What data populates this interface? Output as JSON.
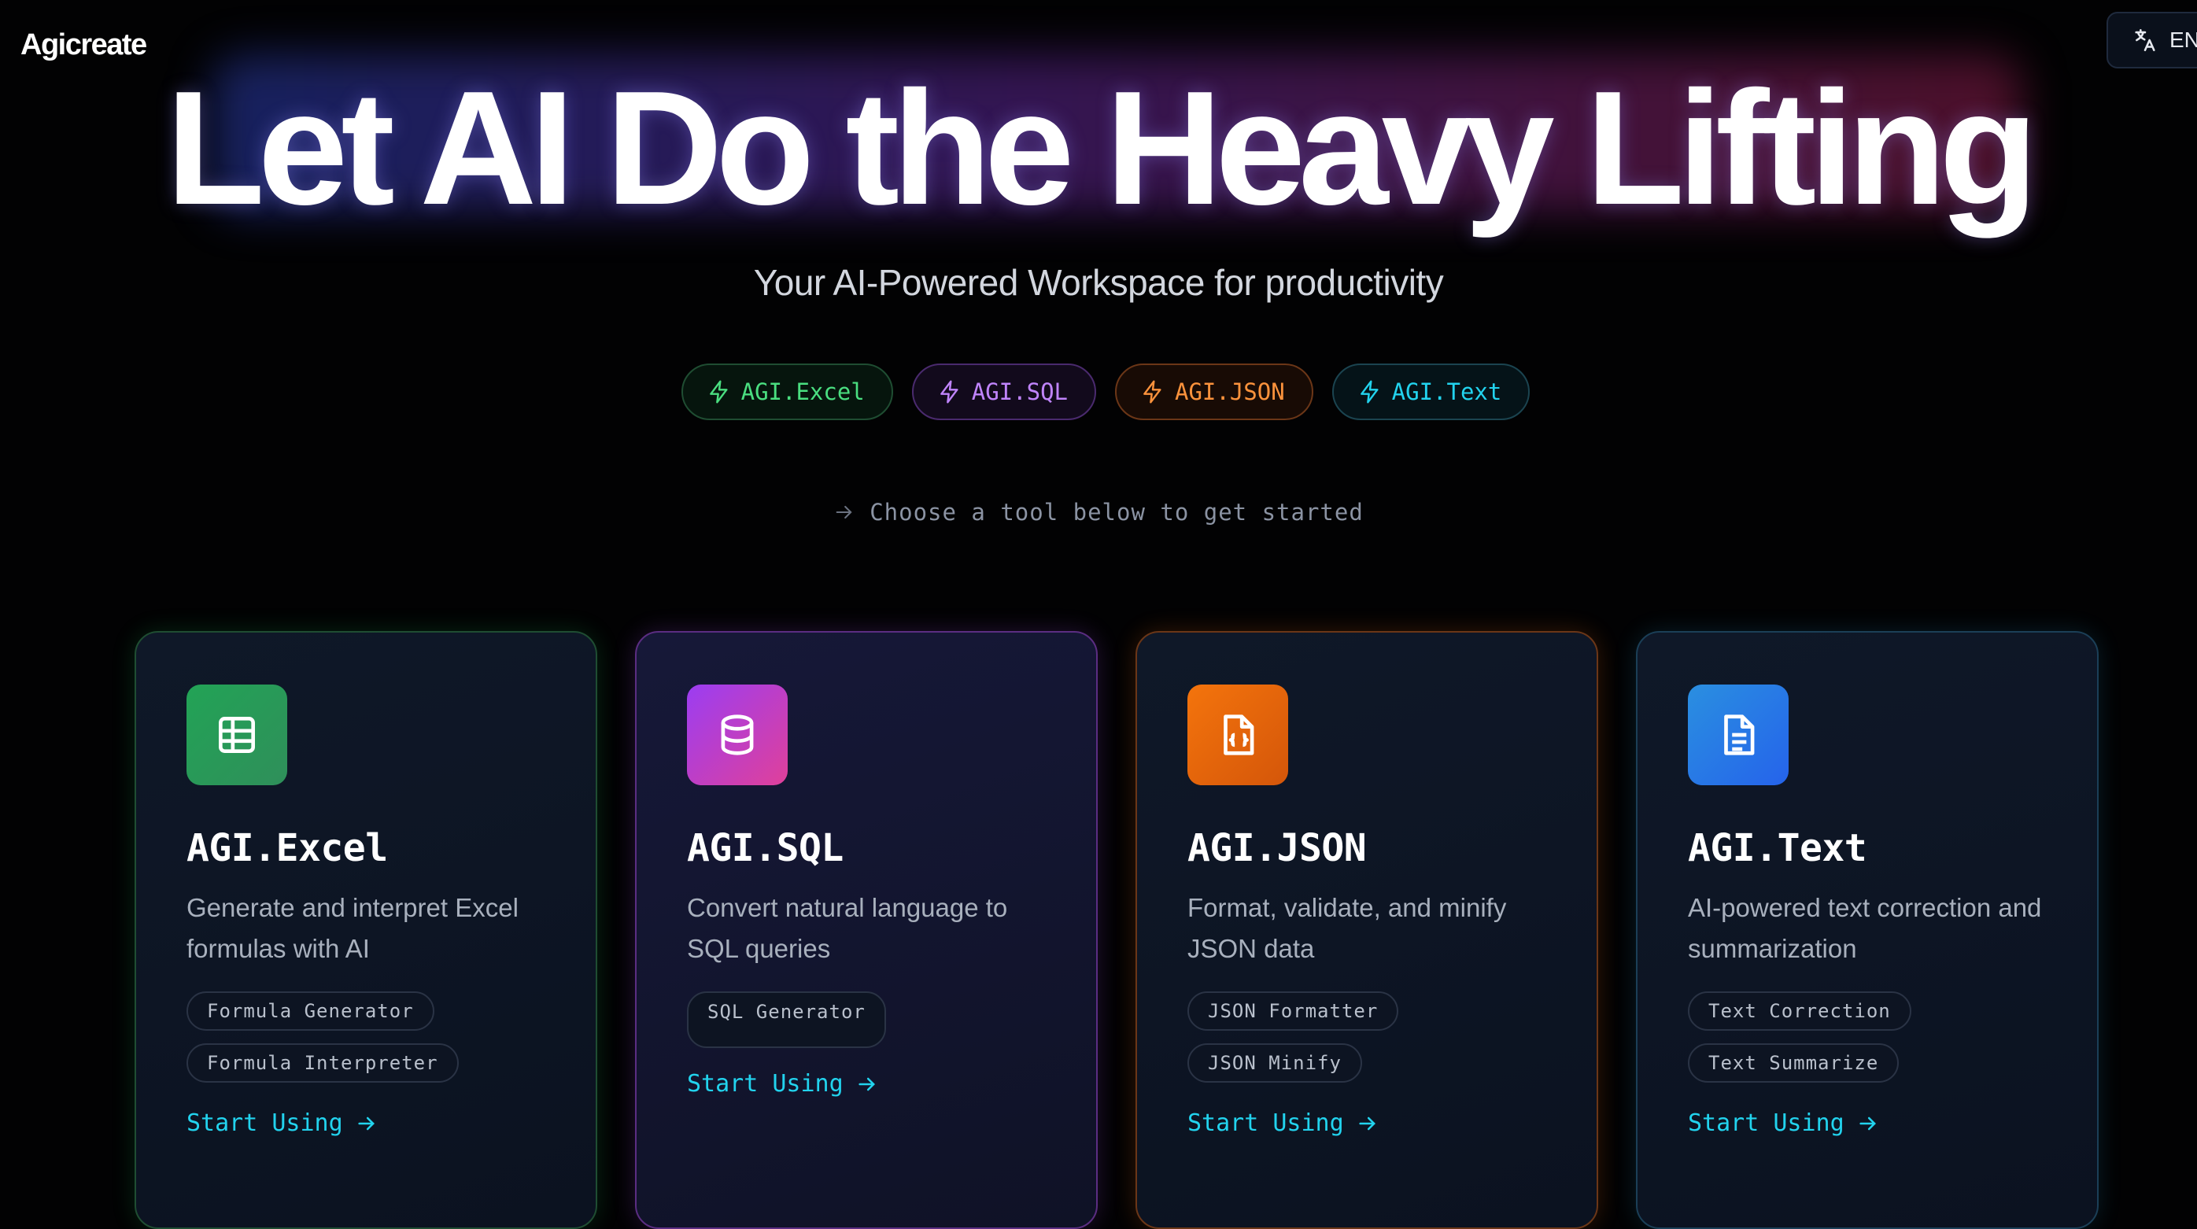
{
  "header": {
    "logo": "Agicreate",
    "language": {
      "label": "EN",
      "icon": "translate-icon"
    }
  },
  "hero": {
    "title": "Let AI Do the Heavy Lifting",
    "subtitle": "Your AI-Powered Workspace for productivity"
  },
  "pills": [
    {
      "label": "AGI.Excel",
      "color": "#4ade80",
      "icon": "lightning-icon"
    },
    {
      "label": "AGI.SQL",
      "color": "#c084fc",
      "icon": "lightning-icon"
    },
    {
      "label": "AGI.JSON",
      "color": "#fb923c",
      "icon": "lightning-icon"
    },
    {
      "label": "AGI.Text",
      "color": "#22d3ee",
      "icon": "lightning-icon"
    }
  ],
  "hint": "Choose a tool below to get started",
  "cards": [
    {
      "title": "AGI.Excel",
      "icon": "table-icon",
      "description": "Generate and interpret Excel formulas with AI",
      "tags": [
        "Formula Generator",
        "Formula Interpreter"
      ],
      "cta": "Start Using"
    },
    {
      "title": "AGI.SQL",
      "icon": "database-icon",
      "description": "Convert natural language to SQL queries",
      "tags": [
        "SQL Generator"
      ],
      "cta": "Start Using"
    },
    {
      "title": "AGI.JSON",
      "icon": "json-file-icon",
      "description": "Format, validate, and minify JSON data",
      "tags": [
        "JSON Formatter",
        "JSON Minify"
      ],
      "cta": "Start Using"
    },
    {
      "title": "AGI.Text",
      "icon": "document-icon",
      "description": "AI-powered text correction and summarization",
      "tags": [
        "Text Correction",
        "Text Summarize"
      ],
      "cta": "Start Using"
    }
  ]
}
